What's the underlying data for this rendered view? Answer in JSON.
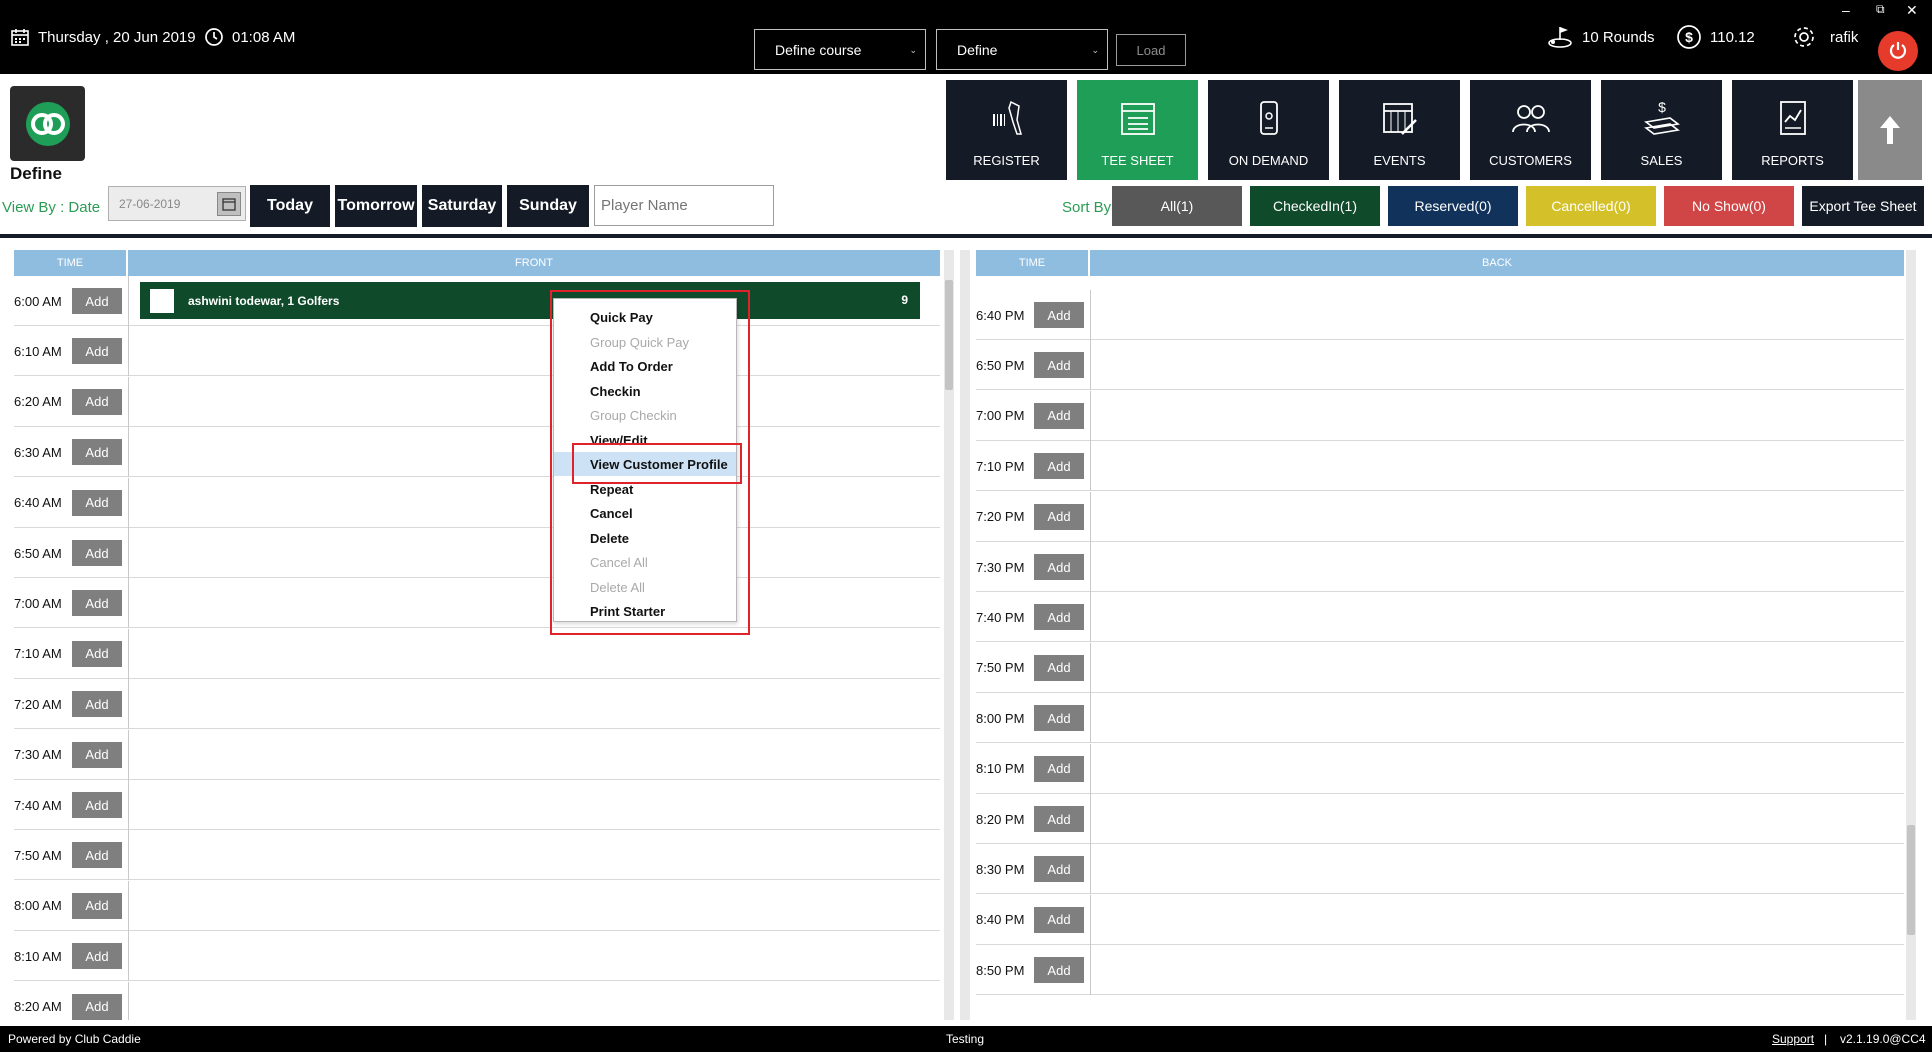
{
  "topbar": {
    "date": "Thursday ,  20 Jun 2019",
    "time": "01:08 AM",
    "course_select": "Define course",
    "define_select": "Define",
    "load_label": "Load",
    "rounds": "10 Rounds",
    "balance": "110.12",
    "user": "rafik",
    "minimize": "–",
    "restore": "⧉",
    "close": "✕"
  },
  "brand": {
    "name": "Define"
  },
  "nav": [
    {
      "label": "REGISTER",
      "icon": "barcode-scanner-icon"
    },
    {
      "label": "TEE SHEET",
      "icon": "calendar-list-icon"
    },
    {
      "label": "ON DEMAND",
      "icon": "mobile-icon"
    },
    {
      "label": "EVENTS",
      "icon": "calendar-edit-icon"
    },
    {
      "label": "CUSTOMERS",
      "icon": "users-icon"
    },
    {
      "label": "SALES",
      "icon": "money-icon"
    },
    {
      "label": "REPORTS",
      "icon": "report-icon"
    }
  ],
  "view": {
    "view_by_label": "View By : Date",
    "date_value": "27-06-2019",
    "days": [
      "Today",
      "Tomorrow",
      "Saturday",
      "Sunday"
    ],
    "player_placeholder": "Player Name",
    "sort_by_label": "Sort By",
    "filters": [
      {
        "label": "All(1)",
        "color": "#585858"
      },
      {
        "label": "CheckedIn(1)",
        "color": "#0f4b2a"
      },
      {
        "label": "Reserved(0)",
        "color": "#11335b"
      },
      {
        "label": "Cancelled(0)",
        "color": "#d4c12a"
      },
      {
        "label": "No Show(0)",
        "color": "#d04545"
      }
    ],
    "export_label": "Export Tee Sheet"
  },
  "front": {
    "time_header": "TIME",
    "header": "FRONT",
    "add_label": "Add",
    "times": [
      "6:00 AM",
      "6:10 AM",
      "6:20 AM",
      "6:30 AM",
      "6:40 AM",
      "6:50 AM",
      "7:00 AM",
      "7:10 AM",
      "7:20 AM",
      "7:30 AM",
      "7:40 AM",
      "7:50 AM",
      "8:00 AM",
      "8:10 AM",
      "8:20 AM"
    ],
    "booking": {
      "name": "ashwini todewar, 1 Golfers",
      "count": "9"
    }
  },
  "back": {
    "time_header": "TIME",
    "header": "BACK",
    "add_label": "Add",
    "times": [
      "6:40 PM",
      "6:50 PM",
      "7:00 PM",
      "7:10 PM",
      "7:20 PM",
      "7:30 PM",
      "7:40 PM",
      "7:50 PM",
      "8:00 PM",
      "8:10 PM",
      "8:20 PM",
      "8:30 PM",
      "8:40 PM",
      "8:50 PM"
    ]
  },
  "context_menu": [
    {
      "label": "Quick Pay",
      "enabled": true
    },
    {
      "label": "Group Quick Pay",
      "enabled": false
    },
    {
      "label": "Add To Order",
      "enabled": true
    },
    {
      "label": "Checkin",
      "enabled": true
    },
    {
      "label": "Group Checkin",
      "enabled": false
    },
    {
      "label": "View/Edit",
      "enabled": true
    },
    {
      "label": "View Customer Profile",
      "enabled": true,
      "highlighted": true
    },
    {
      "label": "Repeat",
      "enabled": true
    },
    {
      "label": "Cancel",
      "enabled": true
    },
    {
      "label": "Delete",
      "enabled": true
    },
    {
      "label": "Cancel All",
      "enabled": false
    },
    {
      "label": "Delete All",
      "enabled": false
    },
    {
      "label": "Print Starter",
      "enabled": true
    }
  ],
  "footer": {
    "powered": "Powered by Club Caddie",
    "env": "Testing",
    "support": "Support",
    "separator": "|",
    "version": "v2.1.19.0@CC4"
  },
  "colors": {
    "nav_bg": "#151b26",
    "nav_active": "#1e9e57",
    "accent_green": "#2c9c55",
    "header_blue": "#8fbde0",
    "highlight_red": "#e0232a"
  }
}
